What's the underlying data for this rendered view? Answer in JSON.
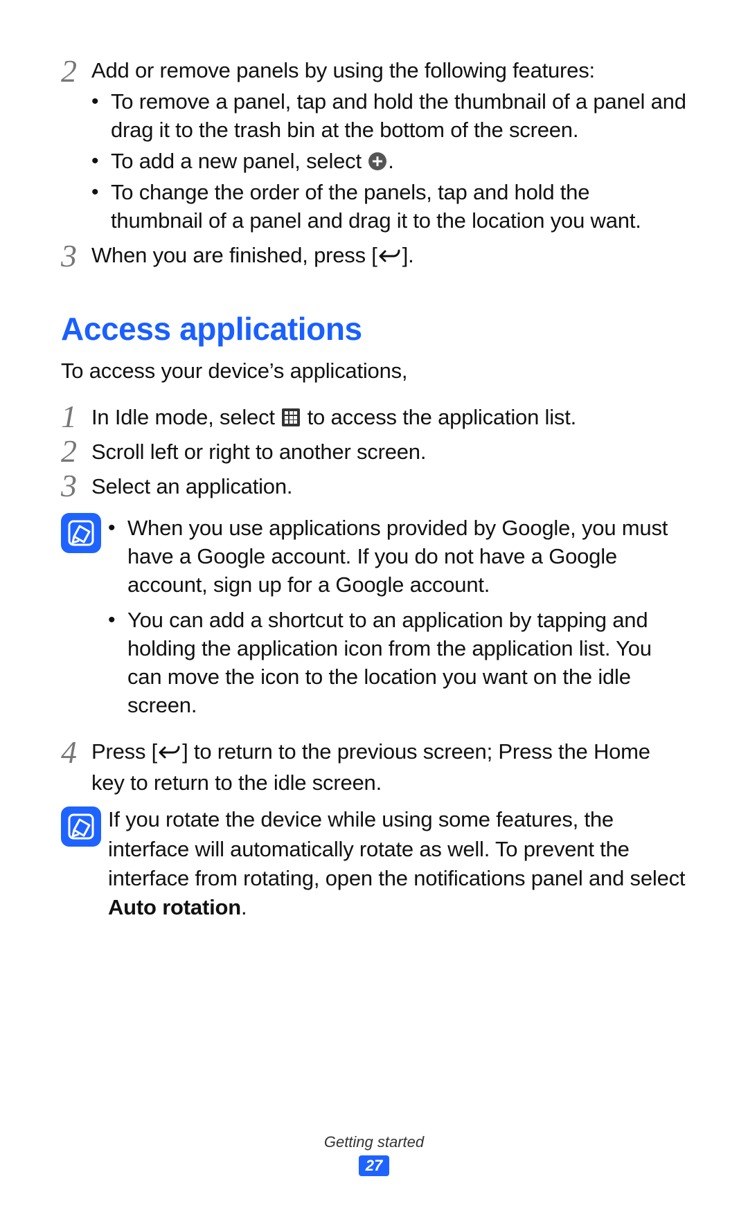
{
  "section1": {
    "step2": {
      "num": "2",
      "text": "Add or remove panels by using the following features:",
      "bullets": [
        {
          "pre": "To remove a panel, tap and hold the thumbnail of a panel and drag it to the trash bin at the bottom of the screen.",
          "icon": null,
          "post": ""
        },
        {
          "pre": "To add a new panel, select ",
          "icon": "plus",
          "post": "."
        },
        {
          "pre": "To change the order of the panels, tap and hold the thumbnail of a panel and drag it to the location you want.",
          "icon": null,
          "post": ""
        }
      ]
    },
    "step3": {
      "num": "3",
      "pre": "When you are finished, press [",
      "icon": "back",
      "post": "]."
    }
  },
  "heading": "Access applications",
  "intro": "To access your device’s applications,",
  "section2": {
    "step1": {
      "num": "1",
      "pre": "In Idle mode, select ",
      "icon": "apps",
      "post": " to access the application list."
    },
    "step2": {
      "num": "2",
      "text": "Scroll left or right to another screen."
    },
    "step3": {
      "num": "3",
      "text": "Select an application."
    }
  },
  "note1": {
    "bullets": [
      "When you use applications provided by Google, you must have a Google account. If you do not have a Google account, sign up for a Google account.",
      "You can add a shortcut to an application by tapping and holding the application icon from the application list. You can move the icon to the location you want on the idle screen."
    ]
  },
  "section3": {
    "step4": {
      "num": "4",
      "pre": "Press [",
      "icon": "back",
      "post": "] to return to the previous screen; Press the Home key to return to the idle screen."
    }
  },
  "note2": {
    "pre": "If you rotate the device while using some features, the interface will automatically rotate as well. To prevent the interface from rotating, open the notifications panel and select ",
    "bold": "Auto rotation",
    "post": "."
  },
  "footer": {
    "section": "Getting started",
    "page": "27"
  }
}
